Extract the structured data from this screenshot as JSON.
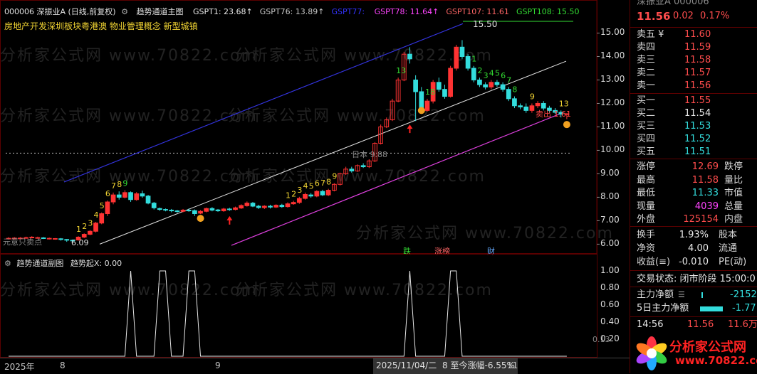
{
  "header": {
    "stock": "000006 深振业A (日线,前复权)",
    "indicator": "趋势通道主图",
    "gspt": [
      {
        "label": "GSPT1: 23.68",
        "arrow": "↑",
        "color": "#e8e8e8"
      },
      {
        "label": "GSPT76: 13.89",
        "arrow": "↑",
        "color": "#c8c8c8"
      },
      {
        "label": "GSPT77: ",
        "arrow": "",
        "color": "#3333ff"
      },
      {
        "label": "GSPT78: 11.64",
        "arrow": "↑",
        "color": "#ff44ff"
      },
      {
        "label": "GSPT107: 11.61",
        "arrow": "",
        "color": "#ff6666"
      },
      {
        "label": "GSPT108: 15.50",
        "arrow": "",
        "color": "#33dd33"
      }
    ],
    "concepts": "房地产开发深圳板块粤港澳 物业管理概念 新型城镇"
  },
  "sub_header": {
    "indicator": "趋势通道副图",
    "value": "趋势起X: 0.00"
  },
  "annotations": {
    "high_price": "15.50",
    "ref_line": "日本 9.88",
    "bottom_left_price": "6.09",
    "left_text": "元意只卖点",
    "buy_label": "买",
    "sell_label": "卖出 1.61",
    "tag_die": "跌",
    "tag_zhangting": "涨榜",
    "tag_cai": "财",
    "sub_right_label": "0.13"
  },
  "axis": {
    "main_ticks": [
      "15.00",
      "14.00",
      "13.00",
      "12.00",
      "11.00",
      "10.00",
      "9.00",
      "8.00",
      "7.00",
      "6.00"
    ],
    "sub_ticks": [
      "1.00",
      "0.80",
      "0.60",
      "0.40",
      "0.20"
    ],
    "bottom_left": "2025年",
    "x_labels": [
      "8",
      "9",
      "11"
    ],
    "cursor_info": "2025/11/04/二",
    "range_info": "8 至今涨幅-6.55%"
  },
  "panel": {
    "name": "深振业A 000006",
    "price": "11.56",
    "change": "0.02",
    "pct": "0.17%",
    "asks": [
      {
        "label": "卖五 ¥",
        "price": "11.60"
      },
      {
        "label": "卖四",
        "price": "11.59"
      },
      {
        "label": "卖三",
        "price": "11.58"
      },
      {
        "label": "卖二",
        "price": "11.57"
      },
      {
        "label": "卖一",
        "price": "11.56"
      }
    ],
    "bids": [
      {
        "label": "买一",
        "price": "11.55"
      },
      {
        "label": "买二",
        "price": "11.54"
      },
      {
        "label": "买三",
        "price": "11.53"
      },
      {
        "label": "买四",
        "price": "11.52"
      },
      {
        "label": "买五",
        "price": "11.51"
      }
    ],
    "stats": [
      {
        "l1": "涨停",
        "v1": "12.69",
        "l2": "跌停",
        "c": "red"
      },
      {
        "l1": "最高",
        "v1": "11.58",
        "l2": "量比",
        "c": "red"
      },
      {
        "l1": "最低",
        "v1": "11.33",
        "l2": "市值",
        "c": "cyan"
      },
      {
        "l1": "现量",
        "v1": "4039",
        "l2": "总量",
        "c": "mag"
      },
      {
        "l1": "外盘",
        "v1": "125154",
        "l2": "内盘",
        "c": "red"
      }
    ],
    "stats2": [
      {
        "l1": "换手",
        "v1": "1.93%",
        "l2": "股本"
      },
      {
        "l1": "净资",
        "v1": "4.00",
        "l2": "流通"
      },
      {
        "l1": "收益(≡)",
        "v1": "-0.010",
        "l2": "PE(动)"
      }
    ],
    "trade_status": "交易状态: 闭市阶段 15:00:0",
    "main_net_label": "主力净额",
    "main_net_value": "-2152",
    "five_day_label": "5日主力净额",
    "five_day_value": "-1.77",
    "tick_time": "14:56",
    "tick_price": "11.56",
    "tick_vol": "11.6万"
  },
  "watermark": "分析家公式网 www.70822.com",
  "logo": {
    "text": "分析家公式网",
    "url": "www.70822.com"
  },
  "chart_data": [
    {
      "type": "candlestick",
      "title": "",
      "ylim": [
        5.8,
        15.5
      ],
      "yticks": [
        6,
        7,
        8,
        9,
        10,
        11,
        12,
        13,
        14,
        15
      ],
      "candles": [
        [
          6.25,
          6.25,
          6.3,
          6.2
        ],
        [
          6.24,
          6.26,
          6.3,
          6.2
        ],
        [
          6.26,
          6.26,
          6.3,
          6.22
        ],
        [
          6.27,
          6.28,
          6.32,
          6.24
        ],
        [
          6.27,
          6.3,
          6.34,
          6.24
        ],
        [
          6.28,
          6.28,
          6.32,
          6.24
        ],
        [
          6.27,
          6.26,
          6.3,
          6.22
        ],
        [
          6.25,
          6.25,
          6.28,
          6.2
        ],
        [
          6.24,
          6.24,
          6.26,
          6.19
        ],
        [
          6.23,
          6.22,
          6.26,
          6.15
        ],
        [
          6.2,
          6.18,
          6.22,
          6.1
        ],
        [
          6.17,
          6.16,
          6.2,
          6.09
        ],
        [
          6.18,
          6.3,
          6.34,
          6.15
        ],
        [
          6.3,
          6.42,
          6.46,
          6.26
        ],
        [
          6.42,
          6.55,
          6.6,
          6.38
        ],
        [
          6.55,
          6.9,
          6.95,
          6.5
        ],
        [
          6.9,
          7.3,
          7.35,
          6.85
        ],
        [
          7.3,
          7.8,
          7.86,
          7.2
        ],
        [
          7.8,
          8.1,
          8.2,
          7.7
        ],
        [
          8.1,
          8.0,
          8.25,
          7.9
        ],
        [
          8.0,
          8.2,
          8.3,
          7.95
        ],
        [
          8.2,
          7.9,
          8.25,
          7.8
        ],
        [
          7.9,
          8.15,
          8.22,
          7.85
        ],
        [
          8.15,
          8.05,
          8.28,
          7.98
        ],
        [
          8.05,
          7.75,
          8.1,
          7.7
        ],
        [
          7.75,
          7.55,
          7.8,
          7.48
        ],
        [
          7.52,
          7.48,
          7.56,
          7.42
        ],
        [
          7.48,
          7.46,
          7.52,
          7.4
        ],
        [
          7.45,
          7.42,
          7.5,
          7.36
        ],
        [
          7.42,
          7.4,
          7.46,
          7.34
        ],
        [
          7.4,
          7.45,
          7.5,
          7.36
        ],
        [
          7.45,
          7.43,
          7.52,
          7.38
        ],
        [
          7.43,
          7.3,
          7.48,
          7.2
        ],
        [
          7.32,
          7.4,
          7.45,
          7.28
        ],
        [
          7.4,
          7.52,
          7.56,
          7.36
        ],
        [
          7.52,
          7.45,
          7.58,
          7.4
        ],
        [
          7.46,
          7.42,
          7.5,
          7.38
        ],
        [
          7.42,
          7.5,
          7.55,
          7.38
        ],
        [
          7.5,
          7.48,
          7.55,
          7.42
        ],
        [
          7.48,
          7.55,
          7.6,
          7.44
        ],
        [
          7.54,
          7.65,
          7.7,
          7.5
        ],
        [
          7.64,
          7.75,
          7.82,
          7.6
        ],
        [
          7.75,
          7.62,
          7.8,
          7.58
        ],
        [
          7.62,
          7.56,
          7.68,
          7.5
        ],
        [
          7.56,
          7.62,
          7.66,
          7.5
        ],
        [
          7.62,
          7.58,
          7.68,
          7.52
        ],
        [
          7.58,
          7.66,
          7.7,
          7.54
        ],
        [
          7.66,
          7.6,
          7.72,
          7.55
        ],
        [
          7.6,
          7.72,
          7.78,
          7.56
        ],
        [
          7.72,
          7.78,
          7.85,
          7.68
        ],
        [
          7.78,
          7.95,
          8.02,
          7.72
        ],
        [
          7.95,
          8.12,
          8.2,
          7.9
        ],
        [
          8.1,
          8.05,
          8.18,
          7.98
        ],
        [
          8.05,
          8.25,
          8.3,
          8.0
        ],
        [
          8.25,
          8.1,
          8.32,
          8.05
        ],
        [
          8.1,
          8.3,
          8.36,
          8.05
        ],
        [
          8.3,
          8.55,
          8.6,
          8.25
        ],
        [
          8.55,
          9.0,
          9.05,
          8.5
        ],
        [
          9.0,
          9.2,
          9.3,
          8.95
        ],
        [
          9.2,
          9.12,
          9.3,
          9.05
        ],
        [
          9.12,
          9.35,
          9.4,
          9.08
        ],
        [
          9.35,
          9.3,
          9.45,
          9.25
        ],
        [
          9.3,
          9.55,
          9.62,
          9.25
        ],
        [
          9.55,
          10.3,
          10.35,
          9.5
        ],
        [
          10.3,
          11.0,
          11.1,
          10.25
        ],
        [
          11.0,
          11.3,
          11.4,
          10.95
        ],
        [
          11.3,
          12.1,
          12.2,
          11.25
        ],
        [
          12.1,
          13.0,
          13.1,
          12.05
        ],
        [
          13.0,
          14.1,
          14.2,
          12.95
        ],
        [
          14.1,
          13.9,
          14.4,
          13.7
        ],
        [
          13.0,
          12.5,
          13.2,
          11.25
        ],
        [
          12.5,
          11.7,
          12.7,
          11.6
        ],
        [
          11.7,
          12.1,
          12.2,
          11.65
        ],
        [
          12.1,
          12.9,
          13.0,
          12.0
        ],
        [
          12.9,
          12.6,
          13.1,
          12.5
        ],
        [
          12.6,
          12.3,
          12.8,
          12.2
        ],
        [
          12.3,
          13.5,
          13.6,
          12.25
        ],
        [
          13.5,
          14.4,
          14.5,
          13.4
        ],
        [
          14.4,
          14.0,
          14.7,
          13.9
        ],
        [
          14.0,
          13.5,
          14.1,
          13.4
        ],
        [
          13.5,
          13.0,
          13.6,
          12.9
        ],
        [
          13.0,
          12.8,
          13.1,
          12.7
        ],
        [
          12.8,
          12.7,
          12.9,
          12.6
        ],
        [
          12.7,
          12.9,
          13.0,
          12.6
        ],
        [
          12.9,
          12.8,
          13.0,
          12.7
        ],
        [
          12.8,
          12.6,
          12.9,
          12.5
        ],
        [
          12.6,
          12.2,
          12.7,
          12.1
        ],
        [
          12.2,
          11.9,
          12.3,
          11.8
        ],
        [
          11.9,
          11.85,
          12.0,
          11.75
        ],
        [
          11.85,
          11.7,
          12.0,
          11.6
        ],
        [
          11.7,
          11.9,
          12.0,
          11.6
        ],
        [
          11.9,
          12.0,
          12.1,
          11.8
        ],
        [
          12.0,
          11.8,
          12.1,
          11.7
        ],
        [
          11.8,
          11.7,
          11.9,
          11.6
        ],
        [
          11.7,
          11.62,
          11.8,
          11.55
        ],
        [
          11.62,
          11.54,
          11.7,
          11.4
        ],
        [
          11.54,
          11.56,
          11.58,
          11.33
        ]
      ],
      "lines": {
        "upper": {
          "color": "#3333dd",
          "from": [
            8.65
          ],
          "to": [
            15.4
          ]
        },
        "middle": {
          "color": "#e0e0e0",
          "from": [
            6.0
          ],
          "to": [
            13.8
          ]
        },
        "lower": {
          "color": "#e040e0",
          "from": [
            5.95
          ],
          "to": [
            11.6
          ]
        }
      },
      "ref_price": 9.88
    },
    {
      "type": "line",
      "title": "",
      "ylim": [
        0,
        1
      ],
      "yticks": [
        0,
        0.2,
        0.4,
        0.6,
        0.8,
        1.0
      ],
      "values": [
        0,
        0,
        0,
        0,
        0,
        0,
        0,
        0,
        0,
        0,
        0,
        0,
        0,
        0,
        0,
        0,
        0,
        0,
        0,
        0,
        0,
        1,
        0,
        0,
        0,
        0,
        1,
        1,
        0,
        0,
        0,
        1,
        1,
        0,
        0,
        0,
        0,
        0,
        0,
        0,
        0,
        0,
        0,
        0,
        0,
        0,
        0,
        0,
        0,
        0,
        0,
        0,
        0,
        0,
        0,
        0,
        0,
        0,
        0,
        0,
        0,
        0,
        0,
        0,
        0,
        0,
        0,
        0,
        0,
        1,
        0,
        0,
        0,
        0,
        0,
        0,
        1,
        1,
        0,
        0,
        0,
        0,
        0,
        0,
        0,
        0,
        0,
        0,
        0,
        0,
        0,
        0,
        0,
        0,
        0,
        0,
        0
      ]
    }
  ]
}
